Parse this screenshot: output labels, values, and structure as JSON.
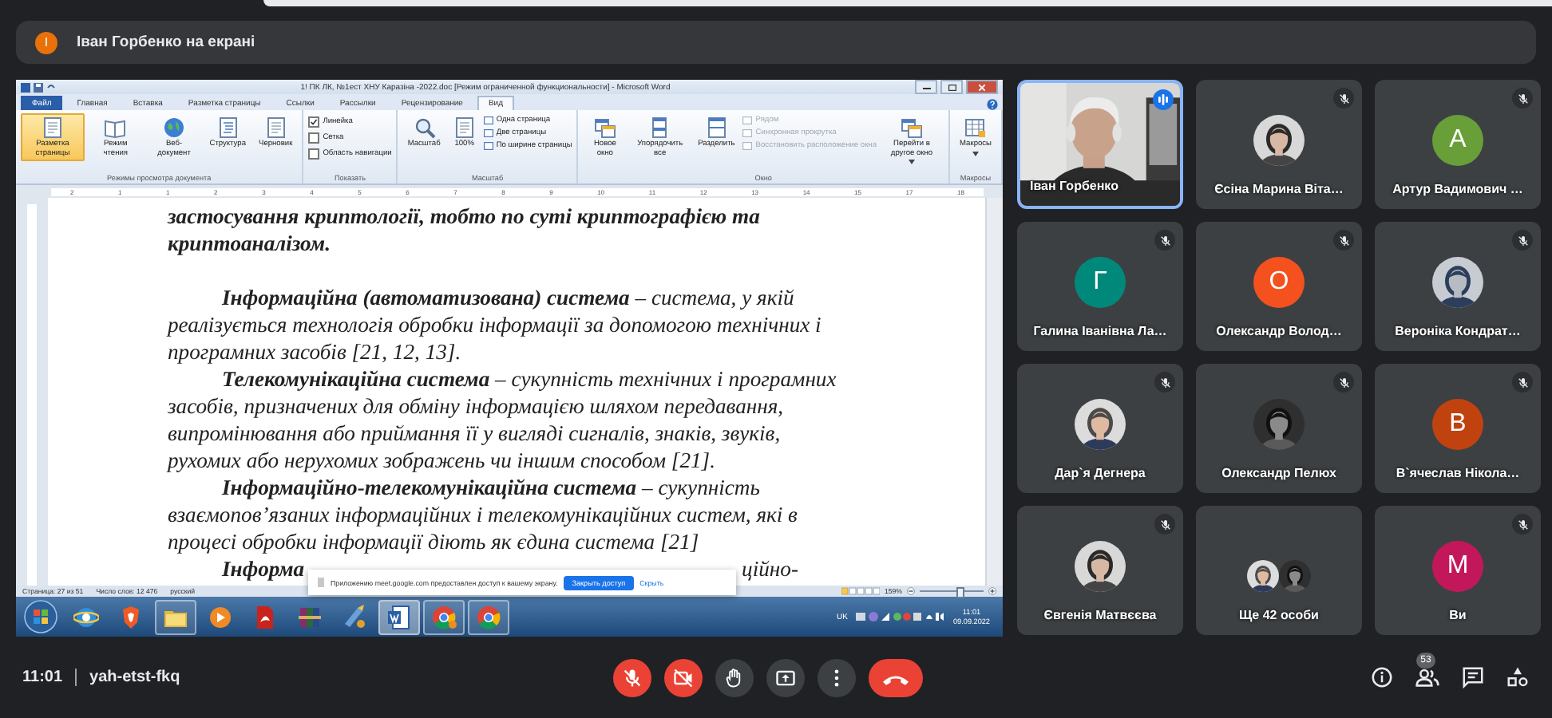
{
  "banner": {
    "avatar_letter": "І",
    "text": "Іван Горбенко на екрані"
  },
  "word": {
    "title": "1! ПК ЛК, №1ест  ХНУ Каразіна -2022.doc [Режим ограниченной функциональности] - Microsoft Word",
    "tabs": [
      {
        "label": "Файл",
        "kind": "file",
        "selected": false
      },
      {
        "label": "Главная",
        "kind": "tab",
        "selected": false
      },
      {
        "label": "Вставка",
        "kind": "tab",
        "selected": false
      },
      {
        "label": "Разметка страницы",
        "kind": "tab",
        "selected": false
      },
      {
        "label": "Ссылки",
        "kind": "tab",
        "selected": false
      },
      {
        "label": "Рассылки",
        "kind": "tab",
        "selected": false
      },
      {
        "label": "Рецензирование",
        "kind": "tab",
        "selected": false
      },
      {
        "label": "Вид",
        "kind": "tab",
        "selected": true
      }
    ],
    "ribbon_groups": [
      {
        "label": "Режимы просмотра документа",
        "items": [
          {
            "kind": "large",
            "label": "Разметка страницы",
            "selected": true
          },
          {
            "kind": "large",
            "label": "Режим чтения",
            "selected": false
          },
          {
            "kind": "large",
            "label": "Веб-документ",
            "selected": false
          },
          {
            "kind": "large",
            "label": "Структура",
            "selected": false
          },
          {
            "kind": "large",
            "label": "Черновик",
            "selected": false
          }
        ]
      },
      {
        "label": "Показать",
        "items": [
          {
            "kind": "check",
            "label": "Линейка",
            "checked": true
          },
          {
            "kind": "check",
            "label": "Сетка",
            "checked": false
          },
          {
            "kind": "check",
            "label": "Область навигации",
            "checked": false
          }
        ]
      },
      {
        "label": "Масштаб",
        "items": [
          {
            "kind": "large",
            "label": "Масштаб",
            "selected": false
          },
          {
            "kind": "large",
            "label": "100%",
            "selected": false
          },
          {
            "kind": "small",
            "label": "Одна страница",
            "disabled": false
          },
          {
            "kind": "small",
            "label": "Две страницы",
            "disabled": false
          },
          {
            "kind": "small",
            "label": "По ширине страницы",
            "disabled": false
          }
        ]
      },
      {
        "label": "Окно",
        "items": [
          {
            "kind": "large",
            "label": "Новое окно",
            "selected": false
          },
          {
            "kind": "large",
            "label": "Упорядочить все",
            "selected": false
          },
          {
            "kind": "large",
            "label": "Разделить",
            "selected": false
          },
          {
            "kind": "small",
            "label": "Рядом",
            "disabled": true
          },
          {
            "kind": "small",
            "label": "Синхронная прокрутка",
            "disabled": true
          },
          {
            "kind": "small",
            "label": "Восстановить расположение окна",
            "disabled": true
          },
          {
            "kind": "large",
            "label": "Перейти в другое окно",
            "selected": false,
            "dropdown": true
          }
        ]
      },
      {
        "label": "Макросы",
        "items": [
          {
            "kind": "large",
            "label": "Макросы",
            "selected": false,
            "dropdown": true
          }
        ]
      }
    ],
    "ruler_labels": [
      "2",
      "1",
      "1",
      "2",
      "3",
      "4",
      "5",
      "6",
      "7",
      "8",
      "9",
      "10",
      "11",
      "12",
      "13",
      "14",
      "15",
      "17",
      "18"
    ],
    "document": {
      "paragraphs": [
        {
          "kind": "tail",
          "text": "застосування  криптології, тобто по суті криптографією та криптоаналізом."
        },
        {
          "kind": "definition",
          "text": "**Інформаційна (автоматизована) система** – система, у якій реалізується технологія обробки інформації за допомогою технічних і програмних засобів [21, 12, 13]."
        },
        {
          "kind": "definition",
          "text": "**Телекомунікаційна система** – сукупність технічних і програмних засобів, призначених для обміну інформацією шляхом передавання, випромінювання або приймання її у вигляді сигналів, знаків, звуків, рухомих або нерухомих зображень чи іншим способом [21]."
        },
        {
          "kind": "definition",
          "text": "**Інформаційно-телекомунікаційна система** – сукупність взаємопов’язаних інформаційних і телекомунікаційних систем, які в процесі обробки інформації діють як єдина система [21]"
        }
      ],
      "cut_line": {
        "start": "Інформа",
        "end": "ційно-"
      }
    },
    "status_bar": {
      "page": "Страница: 27 из 51",
      "words": "Число слов: 12 476",
      "language": "русский",
      "zoom": "159%",
      "zoom_slider": {
        "level": 0.62
      }
    },
    "notice": {
      "text": "Приложению meet.google.com предоставлен доступ к вашему экрану.",
      "button": "Закрыть доступ",
      "link": "Скрыть"
    },
    "taskbar": {
      "apps": [
        {
          "kind": "ie",
          "running": false,
          "selected": false,
          "notification": false
        },
        {
          "kind": "brave",
          "running": false,
          "selected": false,
          "notification": false
        },
        {
          "kind": "explorer",
          "running": true,
          "selected": false,
          "notification": false
        },
        {
          "kind": "media",
          "running": false,
          "selected": false,
          "notification": false
        },
        {
          "kind": "pdf",
          "running": false,
          "selected": false,
          "notification": false
        },
        {
          "kind": "winrar",
          "running": false,
          "selected": false,
          "notification": false
        },
        {
          "kind": "paint",
          "running": false,
          "selected": false,
          "notification": false
        },
        {
          "kind": "word",
          "running": true,
          "selected": true,
          "notification": false
        },
        {
          "kind": "chrome",
          "running": true,
          "selected": false,
          "notification": true
        },
        {
          "kind": "chrome",
          "running": true,
          "selected": false,
          "notification": false
        }
      ],
      "language": "UK",
      "time": "11:01",
      "date": "09.09.2022"
    }
  },
  "participants": [
    {
      "name": "Іван Горбенко",
      "muted": false,
      "speaking": true,
      "avatar": {
        "kind": "video"
      }
    },
    {
      "name": "Єсіна Марина Віта…",
      "muted": true,
      "speaking": false
    },
    {
      "name": "Артур Вадимович …",
      "muted": true,
      "speaking": false,
      "avatar": {
        "kind": "letter",
        "letter": "А",
        "color": "#689f38"
      }
    },
    {
      "name": "Галина Іванівна Ла…",
      "muted": true,
      "speaking": false,
      "avatar": {
        "kind": "letter",
        "letter": "Г",
        "color": "#00897b"
      }
    },
    {
      "name": "Олександр Волод…",
      "muted": true,
      "speaking": false,
      "avatar": {
        "kind": "letter",
        "letter": "О",
        "color": "#f4511e"
      }
    },
    {
      "name": "Вероніка Кондрат…",
      "muted": true,
      "speaking": false
    },
    {
      "name": "Дар`я Дегнера",
      "muted": true,
      "speaking": false
    },
    {
      "name": "Олександр Пелюх",
      "muted": true,
      "speaking": false
    },
    {
      "name": "В`ячеслав Нікола…",
      "muted": true,
      "speaking": false,
      "avatar": {
        "kind": "letter",
        "letter": "В",
        "color": "#c0430f"
      }
    },
    {
      "name": "Євгенія Матвєєва",
      "muted": true,
      "speaking": false
    },
    {
      "name": "Ще 42 особи",
      "muted": false,
      "speaking": false,
      "avatar": {
        "kind": "group"
      }
    },
    {
      "name": "Ви",
      "muted": true,
      "speaking": false,
      "avatar": {
        "kind": "letter",
        "letter": "М",
        "color": "#c2185b"
      }
    }
  ],
  "meeting": {
    "time": "11:01",
    "code": "yah-etst-fkq",
    "controls": [
      {
        "kind": "mic",
        "on": false
      },
      {
        "kind": "camera",
        "on": false
      },
      {
        "kind": "hand"
      },
      {
        "kind": "present"
      },
      {
        "kind": "more"
      },
      {
        "kind": "hangup"
      }
    ],
    "side_controls": [
      {
        "kind": "info"
      },
      {
        "kind": "people",
        "badge": "53"
      },
      {
        "kind": "chat"
      },
      {
        "kind": "activities"
      }
    ]
  }
}
